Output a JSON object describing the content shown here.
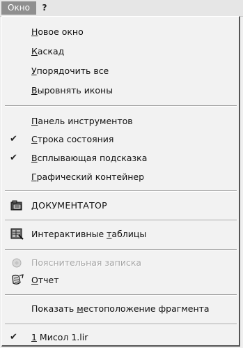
{
  "menubar": {
    "window_label": "Окно",
    "help_label": "?"
  },
  "menu": {
    "new_window": {
      "pre": "",
      "acc": "Н",
      "post": "овое окно"
    },
    "cascade": {
      "pre": "",
      "acc": "К",
      "post": "аскад"
    },
    "arrange_all": {
      "pre": "",
      "acc": "У",
      "post": "порядочить все"
    },
    "arrange_icons": {
      "pre": "",
      "acc": "В",
      "post": "ыровнять иконы"
    },
    "toolbar": {
      "pre": "",
      "acc": "П",
      "post": "анель инструментов"
    },
    "status_bar": {
      "pre": "",
      "acc": "С",
      "post": "трока состояния",
      "checked": true
    },
    "tooltip": {
      "pre": "",
      "acc": "В",
      "post": "сплывающая подсказка",
      "checked": true
    },
    "graphic_container": {
      "pre": "",
      "acc": "Г",
      "post": "рафический контейнер"
    },
    "documentator": {
      "pre": "",
      "acc": "Д",
      "post": "ОКУМЕНТАТОР"
    },
    "interactive_tables": {
      "pre": "Интерактивные ",
      "acc": "т",
      "post": "аблицы"
    },
    "explanatory_note": {
      "pre": "Пояснительная записка",
      "acc": "",
      "post": "",
      "enabled": false
    },
    "report": {
      "pre": "",
      "acc": "О",
      "post": "тчет"
    },
    "show_location": {
      "pre": "Показать ",
      "acc": "м",
      "post": "естоположение фрагмента"
    },
    "doc_1": {
      "pre": "",
      "acc": "1",
      "post": " Мисол 1.lir",
      "checked": true
    }
  },
  "icons": {
    "check": "checkmark-icon",
    "documentator": "folder-documentator-icon",
    "interactive_tables": "table-icon",
    "explanatory_note": "note-icon",
    "report": "report-icon"
  }
}
